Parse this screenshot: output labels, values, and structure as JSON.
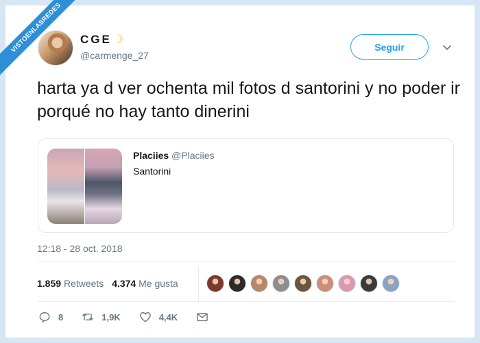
{
  "watermark": "VISTOENLASREDES",
  "user": {
    "name": "CGE",
    "emoji": "☽",
    "handle": "@carmenge_27"
  },
  "follow_label": "Seguir",
  "tweet": {
    "text": "harta ya d ver ochenta mil fotos d santorini y no poder ir porqué no hay tanto dinerini"
  },
  "quote": {
    "name": "Placiies",
    "handle": "@Placiies",
    "text": "Santorini"
  },
  "timestamp": "12:18 - 28 oct. 2018",
  "stats": {
    "retweets_count": "1.859",
    "retweets_label": "Retweets",
    "likes_count": "4.374",
    "likes_label": "Me gusta"
  },
  "likers": [
    "#7a3b2c",
    "#2f2a2a",
    "#b8876a",
    "#8e8e8e",
    "#6b5540",
    "#c98f7a",
    "#d89ab0",
    "#3b3b3b",
    "#8aa3c0"
  ],
  "actions": {
    "replies": "8",
    "retweets": "1,9K",
    "likes": "4,4K"
  },
  "colors": {
    "accent": "#1da1f2",
    "secondary_text": "#657786",
    "ribbon": "#2d8fd6",
    "background": "#d6e6f4"
  }
}
